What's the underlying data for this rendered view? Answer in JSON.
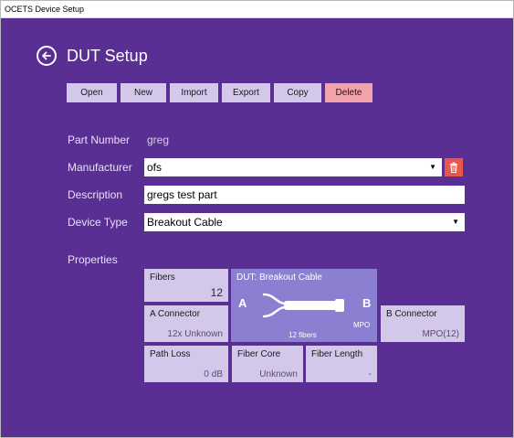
{
  "window": {
    "title": "OCETS Device Setup"
  },
  "header": {
    "title": "DUT Setup",
    "back_icon": "circle-arrow-left-icon"
  },
  "toolbar": {
    "open": "Open",
    "new": "New",
    "import": "Import",
    "export": "Export",
    "copy": "Copy",
    "delete": "Delete"
  },
  "form": {
    "part_number_label": "Part Number",
    "part_number_value": "greg",
    "manufacturer_label": "Manufacturer",
    "manufacturer_value": "ofs",
    "description_label": "Description",
    "description_value": "gregs test part",
    "device_type_label": "Device Type",
    "device_type_value": "Breakout Cable",
    "properties_label": "Properties"
  },
  "properties": {
    "fibers_label": "Fibers",
    "fibers_value": "12",
    "dut_title": "DUT: Breakout Cable",
    "end_a": "A",
    "end_b": "B",
    "mpo_text": "MPO",
    "fibers_text": "12 fibers",
    "a_connector_label": "A Connector",
    "a_connector_value": "12x Unknown",
    "b_connector_label": "B Connector",
    "b_connector_value": "MPO(12)",
    "path_loss_label": "Path Loss",
    "path_loss_value": "0 dB",
    "fiber_core_label": "Fiber Core",
    "fiber_core_value": "Unknown",
    "fiber_length_label": "Fiber Length",
    "fiber_length_value": "-"
  },
  "colors": {
    "background": "#5a2f94",
    "button": "#d4c8ea",
    "delete": "#f1a3a9",
    "card": "#8a7fd0",
    "trash": "#e9564c"
  }
}
